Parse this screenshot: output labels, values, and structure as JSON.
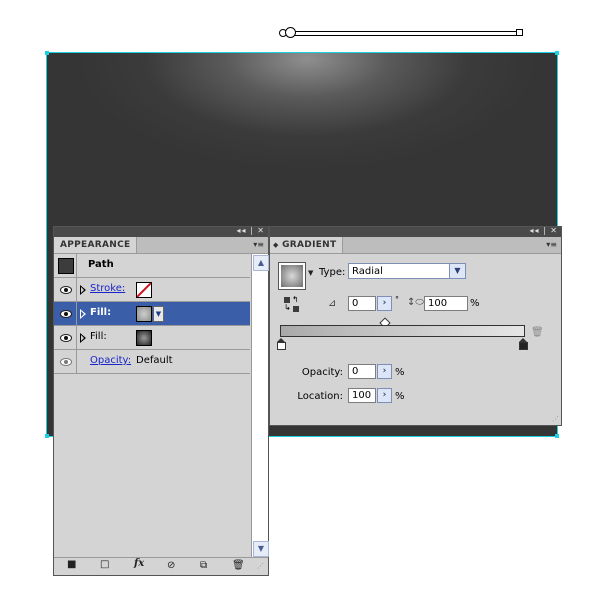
{
  "appearance_panel": {
    "tab_title": "APPEARANCE",
    "window_controls": "◂◂ | ✕",
    "menu_icon": "▾≡",
    "object_type": "Path",
    "rows": [
      {
        "label": "Stroke:",
        "swatch": "none-swatch"
      },
      {
        "label": "Fill:",
        "swatch": "radial-gradient-swatch",
        "selected": true
      },
      {
        "label": "Fill:",
        "swatch": "dark-radial-gradient-swatch"
      },
      {
        "label": "Opacity:",
        "value": "Default"
      }
    ],
    "bottom_icons": [
      "add-new-stroke-icon",
      "add-new-fill-icon",
      "fx-icon",
      "clear-appearance-icon",
      "duplicate-item-icon",
      "delete-item-icon"
    ],
    "fx_label": "fx"
  },
  "gradient_panel": {
    "tab_title": "GRADIENT",
    "tab_prefix": "◆",
    "window_controls": "◂◂ | ✕",
    "menu_icon": "▾≡",
    "type_label": "Type:",
    "type_value": "Radial",
    "angle_value": "0",
    "degree_symbol": "°",
    "aspect_value": "100",
    "aspect_unit": "%",
    "opacity_label": "Opacity:",
    "opacity_value": "0",
    "opacity_unit": "%",
    "location_label": "Location:",
    "location_value": "100",
    "location_unit": "%",
    "stops": [
      {
        "color": "#ffffff",
        "location": 0
      },
      {
        "color": "#222222",
        "location": 100
      }
    ]
  },
  "colors": {
    "selection_highlight": "#3a5ea8",
    "bounding_box": "#1fd0e0",
    "link_text": "#1a24c9"
  }
}
